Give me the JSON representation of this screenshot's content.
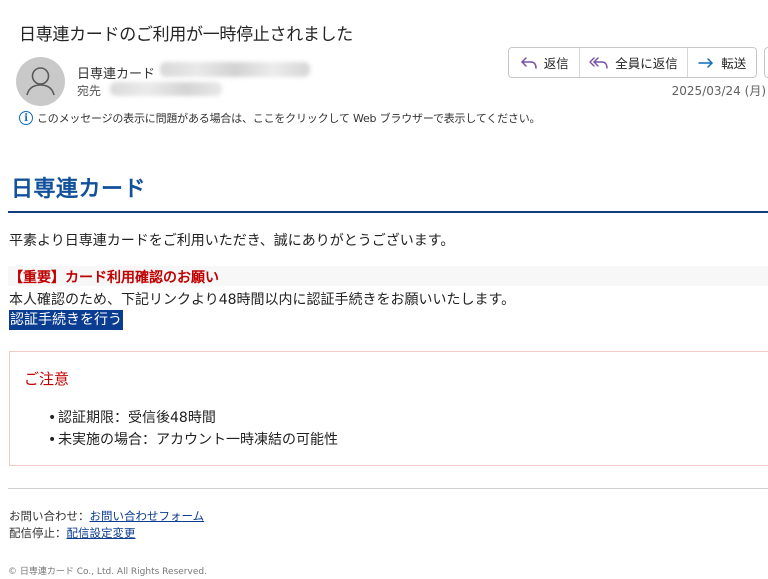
{
  "header": {
    "subject": "日専連カードのご利用が一時停止されました",
    "sender_name": "日専連カード",
    "to_label": "宛先",
    "date": "2025/03/24 (月)",
    "actions": {
      "reply": "返信",
      "reply_all": "全員に返信",
      "forward": "転送"
    },
    "info_notice": "このメッセージの表示に問題がある場合は、ここをクリックして Web ブラウザーで表示してください。"
  },
  "body": {
    "brand": "日専連カード",
    "greeting": "平素より日専連カードをご利用いただき、誠にありがとうございます。",
    "important_title": "【重要】カード利用確認のお願い",
    "instruction": "本人確認のため、下記リンクより48時間以内に認証手続きをお願いいたします。",
    "auth_link": "認証手続きを行う",
    "notice": {
      "title": "ご注意",
      "items": [
        "認証期限：受信後48時間",
        "未実施の場合：アカウント一時凍結の可能性"
      ]
    }
  },
  "footer": {
    "contact_label": "お問い合わせ：",
    "contact_link": "お問い合わせフォーム",
    "unsubscribe_label": "配信停止：",
    "unsubscribe_link": "配信設定変更",
    "copyright": "© 日専連カード Co., Ltd. All Rights Reserved."
  },
  "colors": {
    "brand": "#11509a",
    "alert": "#c00000",
    "link_highlight": "#0a3d91",
    "action_icon": "#7a4fa3"
  },
  "icons": {
    "avatar": "person-icon",
    "reply": "reply-icon",
    "reply_all": "reply-all-icon",
    "forward": "forward-icon",
    "info": "info-icon"
  }
}
